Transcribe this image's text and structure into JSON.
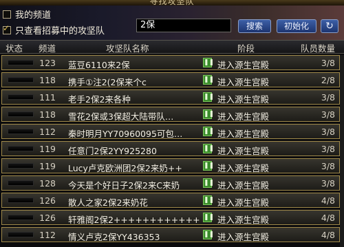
{
  "window": {
    "title": "寻找攻坚队"
  },
  "options": {
    "my_channel": {
      "label": "我的频道",
      "checked": false
    },
    "recruiting_only": {
      "label": "只查看招募中的攻坚队",
      "checked": true
    }
  },
  "search": {
    "value": "2保",
    "search_label": "搜索",
    "init_label": "初始化",
    "refresh_icon": "refresh-icon"
  },
  "columns": {
    "status": "状态",
    "channel": "频道",
    "name": "攻坚队名称",
    "phase": "阶段",
    "members": "队员数量"
  },
  "rows": [
    {
      "channel": "123",
      "name": "蓝豆6110来2保",
      "phase": "进入源生宫殿",
      "members": "3/8"
    },
    {
      "channel": "118",
      "name": "携手①注2(2保来个c",
      "phase": "进入源生宫殿",
      "members": "2/8"
    },
    {
      "channel": "111",
      "name": "老手2保2来各种",
      "phase": "进入源生宫殿",
      "members": "3/8"
    },
    {
      "channel": "118",
      "name": "雪花2保或3保超大陆带队…",
      "phase": "进入源生宫殿",
      "members": "3/8"
    },
    {
      "channel": "112",
      "name": "秦时明月YY70960095可包…",
      "phase": "进入源生宫殿",
      "members": "3/8"
    },
    {
      "channel": "119",
      "name": "任意门2保2YY925280",
      "phase": "进入源生宫殿",
      "members": "3/8"
    },
    {
      "channel": "119",
      "name": "Lucy卢克欧洲团2保2来奶++",
      "phase": "进入源生宫殿",
      "members": "3/8"
    },
    {
      "channel": "128",
      "name": "今天是个好日子2保2来C来奶",
      "phase": "进入源生宫殿",
      "members": "3/8"
    },
    {
      "channel": "126",
      "name": "散人之家2保2来奶花",
      "phase": "进入源生宫殿",
      "members": "4/8"
    },
    {
      "channel": "126",
      "name": "轩雅阁2保2++++++++++++",
      "phase": "进入源生宫殿",
      "members": "4/8"
    },
    {
      "channel": "112",
      "name": "情义卢克2保YY436353",
      "phase": "进入源生宫殿",
      "members": "4/8"
    }
  ]
}
